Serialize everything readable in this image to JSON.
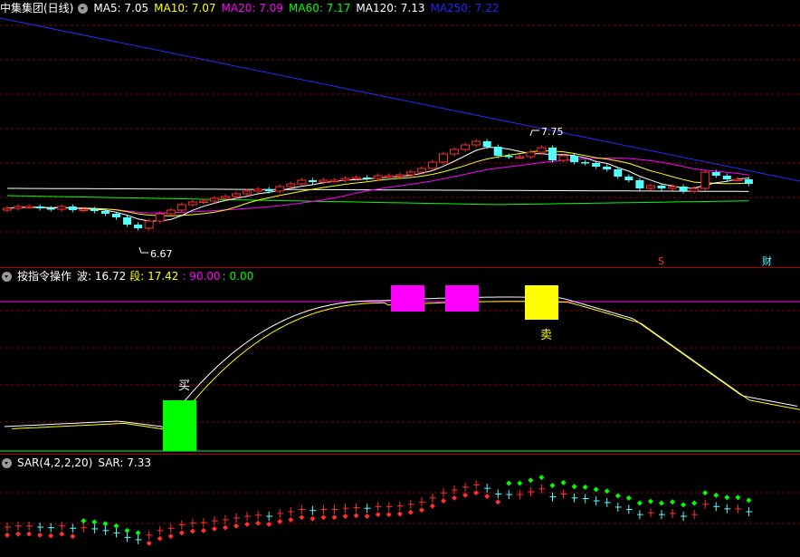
{
  "panel1": {
    "title": "中集集团(日线)",
    "ma": [
      {
        "label": "MA5: 7.05",
        "color": "#ffffff"
      },
      {
        "label": "MA10: 7.07",
        "color": "#ffff00"
      },
      {
        "label": "MA20: 7.09",
        "color": "#ff00ff"
      },
      {
        "label": "MA60: 7.17",
        "color": "#00ff00"
      },
      {
        "label": "MA120: 7.13",
        "color": "#ffffff"
      },
      {
        "label": "MA250: 7.22",
        "color": "#0000ff"
      }
    ],
    "high_label": "7.75",
    "low_label": "6.67",
    "marker_s": "S",
    "marker_cai": "财"
  },
  "panel2": {
    "title": "按指令操作",
    "wave": "波: 16.72",
    "seg": "段: 17.42",
    "v1": ": 90.00",
    "v2": ": 0.00",
    "buy_label": "买",
    "sell_label": "卖"
  },
  "panel3": {
    "title": "SAR(4,2,2,20)",
    "sar": "SAR: 7.33"
  },
  "colors": {
    "up": "#ff3030",
    "down": "#54ffff",
    "bg": "#000000",
    "grid": "#8a0000",
    "buy": "#00ff00",
    "sell": "#ffff00",
    "signal": "#ff00ff"
  },
  "chart_data": {
    "type": "candlestick",
    "closes": [
      6.98,
      7.0,
      7.0,
      6.98,
      6.97,
      7.0,
      6.96,
      6.97,
      6.95,
      6.92,
      6.88,
      6.8,
      6.76,
      6.84,
      6.92,
      6.96,
      7.02,
      7.05,
      7.06,
      7.09,
      7.11,
      7.14,
      7.17,
      7.19,
      7.17,
      7.22,
      7.25,
      7.29,
      7.27,
      7.29,
      7.29,
      7.31,
      7.32,
      7.31,
      7.34,
      7.34,
      7.35,
      7.38,
      7.42,
      7.49,
      7.58,
      7.63,
      7.68,
      7.72,
      7.66,
      7.56,
      7.55,
      7.55,
      7.6,
      7.65,
      7.51,
      7.56,
      7.49,
      7.48,
      7.44,
      7.41,
      7.33,
      7.29,
      7.2,
      7.23,
      7.2,
      7.22,
      7.17,
      7.2,
      7.38,
      7.34,
      7.3,
      7.3,
      7.25
    ],
    "sell_marker": "S",
    "finance_marker": "财"
  }
}
